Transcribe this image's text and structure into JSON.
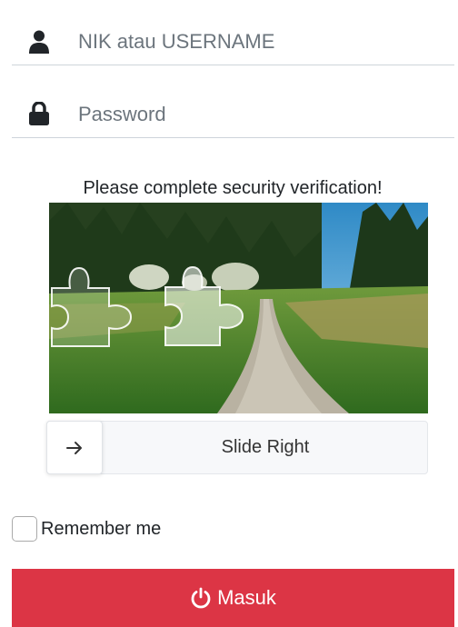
{
  "login": {
    "username_placeholder": "NIK atau USERNAME",
    "password_placeholder": "Password"
  },
  "captcha": {
    "message": "Please complete security verification!",
    "slider_label": "Slide Right",
    "handle_icon": "arrow-right-icon"
  },
  "remember": {
    "label": "Remember me",
    "checked": false
  },
  "submit": {
    "label": "Masuk",
    "icon": "power-icon",
    "color": "#dc3545"
  },
  "icons": {
    "username": "user-icon",
    "password": "lock-icon"
  }
}
